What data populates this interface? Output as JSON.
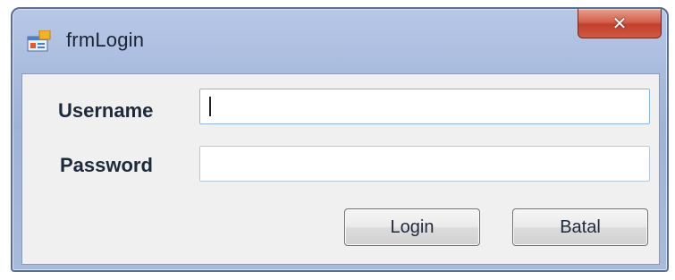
{
  "window": {
    "title": "frmLogin",
    "close_glyph": "✕",
    "icon": "form-icon"
  },
  "form": {
    "username_label": "Username",
    "password_label": "Password",
    "username_value": "",
    "password_value": "",
    "login_label": "Login",
    "cancel_label": "Batal"
  },
  "colors": {
    "frame": "#a9bbdc",
    "close_button": "#c2402c",
    "client_bg": "#f0f0f0"
  }
}
